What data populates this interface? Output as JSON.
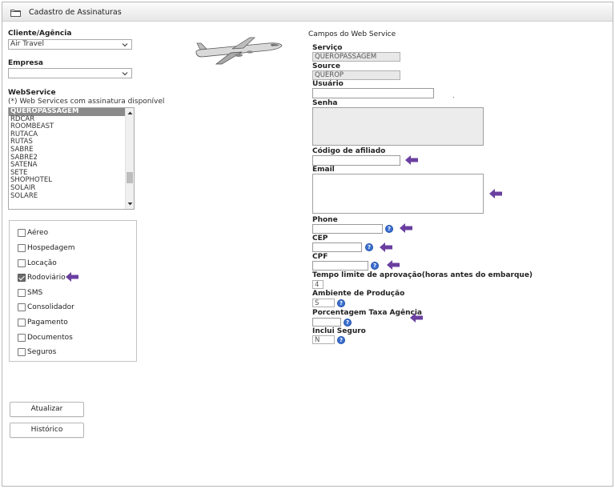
{
  "window": {
    "title": "Cadastro de Assinaturas",
    "folder_icon": "folder-icon"
  },
  "left": {
    "client": {
      "label": "Cliente/Agência",
      "value": "Air Travel"
    },
    "company": {
      "label": "Empresa",
      "value": ""
    },
    "webservice": {
      "label": "WebService",
      "note": "(*) Web Services com assinatura disponível",
      "options": [
        "QUEROPASSAGEM",
        "RDCAR",
        "ROOMBEAST",
        "RUTACA",
        "RUTAS",
        "SABRE",
        "SABRE2",
        "SATENA",
        "SETE",
        "SHOPHOTEL",
        "SOLAIR",
        "SOLARE"
      ],
      "selected": "QUEROPASSAGEM"
    },
    "checkboxes": [
      {
        "label": "Aéreo",
        "checked": false
      },
      {
        "label": "Hospedagem",
        "checked": false
      },
      {
        "label": "Locação",
        "checked": false
      },
      {
        "label": "Rodoviário",
        "checked": true
      },
      {
        "label": "SMS",
        "checked": false
      },
      {
        "label": "Consolidador",
        "checked": false
      },
      {
        "label": "Pagamento",
        "checked": false
      },
      {
        "label": "Documentos",
        "checked": false
      },
      {
        "label": "Seguros",
        "checked": false
      }
    ],
    "buttons": {
      "update": "Atualizar",
      "history": "Histórico"
    }
  },
  "right": {
    "heading": "Campos do Web Service",
    "service": {
      "label": "Serviço",
      "value": "QUEROPASSAGEM"
    },
    "source": {
      "label": "Source",
      "value": "QUEROP"
    },
    "user": {
      "label": "Usuário",
      "value": ""
    },
    "password": {
      "label": "Senha",
      "value": ""
    },
    "affiliate": {
      "label": "Código de afiliado",
      "value": ""
    },
    "email": {
      "label": "Email",
      "value": ""
    },
    "phone": {
      "label": "Phone",
      "value": ""
    },
    "cep": {
      "label": "CEP",
      "value": ""
    },
    "cpf": {
      "label": "CPF",
      "value": ""
    },
    "time_limit": {
      "label": "Tempo limite de aprovação(horas antes do embarque)",
      "value": "4"
    },
    "environment": {
      "label": "Ambiente de Produção",
      "value": "S"
    },
    "agency_fee": {
      "label": "Porcentagem Taxa Agência",
      "value": ""
    },
    "insurance": {
      "label": "Inclui Seguro",
      "value": "N"
    },
    "help_glyph": "?"
  },
  "colors": {
    "arrow": "#6a3fa0",
    "help": "#3a6fd0",
    "selected_option": "#8a8a8a"
  }
}
